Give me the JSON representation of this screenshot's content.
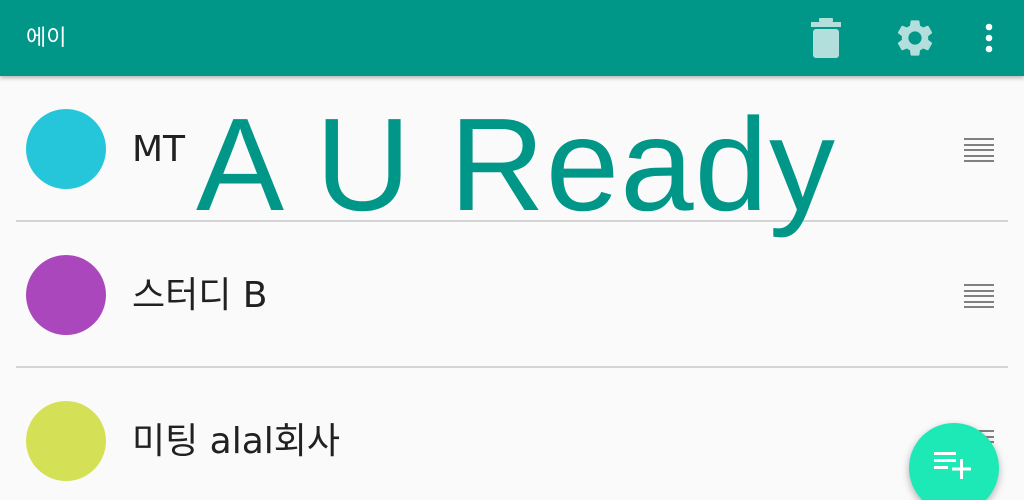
{
  "appbar": {
    "title": "에이",
    "color": "#009688",
    "actions": [
      {
        "name": "delete",
        "icon": "trash-icon"
      },
      {
        "name": "settings",
        "icon": "gear-icon"
      },
      {
        "name": "more",
        "icon": "more-vertical-icon"
      }
    ]
  },
  "overlay_text": "A U Ready",
  "items": [
    {
      "label": "MT",
      "color": "#26c6da",
      "handle_icon": "drag-handle-icon"
    },
    {
      "label": "스터디 B",
      "color": "#ab47bc",
      "handle_icon": "drag-handle-icon"
    },
    {
      "label": "미팅 alal회사",
      "color": "#d4e157",
      "handle_icon": "drag-handle-icon"
    }
  ],
  "fab": {
    "icon": "playlist-add-icon",
    "color": "#1de9b6"
  }
}
